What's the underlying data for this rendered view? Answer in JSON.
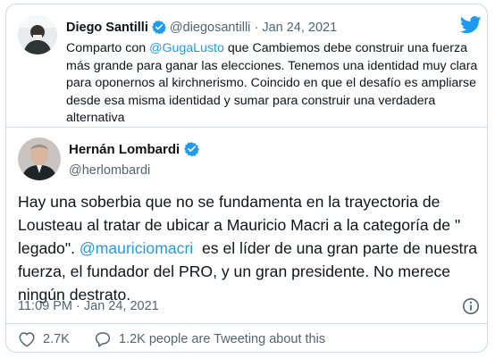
{
  "quoted_tweet": {
    "author_name": "Diego Santilli",
    "handle": "@diegosantilli",
    "separator": "·",
    "date": "Jan 24, 2021",
    "text_before_mention": "Comparto con ",
    "mention": "@GugaLusto",
    "text_after_mention": " que Cambiemos debe construir una fuerza más grande para ganar las elecciones. Tenemos una identidad muy clara para oponernos al kirchnerismo. Coincido en que el desafío es ampliarse desde esa misma identidad y sumar para construir una verdadera alternativa"
  },
  "tweet": {
    "author_name": "Hernán Lombardi",
    "handle": "@herlombardi",
    "text_before_mention": "Hay una soberbia que no se fundamenta en la trayectoria de Lousteau al tratar de ubicar a Mauricio Macri a la categoría de \" legado\". ",
    "mention": "@mauriciomacri",
    "text_after_mention": "  es el líder de una gran parte de nuestra fuerza, el fundador del PRO, y un gran presidente. No merece ningún destrato.",
    "timestamp": "11:09 PM · Jan 24, 2021"
  },
  "actions": {
    "likes": "2.7K",
    "replies_text": "1.2K people are Tweeting about this"
  },
  "icons": {
    "brand": "twitter-bird-icon",
    "verified": "verified-badge-icon",
    "info": "info-icon",
    "like": "heart-icon",
    "reply": "speech-bubble-icon"
  },
  "colors": {
    "brand_blue": "#1d9bf0",
    "text": "#0f1419",
    "muted": "#536471",
    "border": "#cfd9de"
  }
}
